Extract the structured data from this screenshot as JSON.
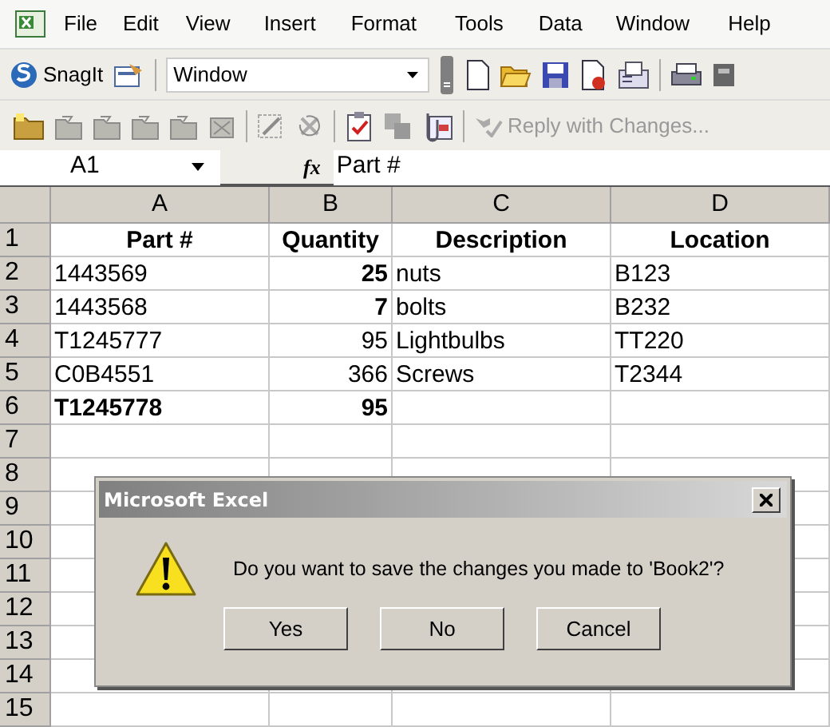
{
  "menu_bar": {
    "items": [
      "File",
      "Edit",
      "View",
      "Insert",
      "Format",
      "Tools",
      "Data",
      "Window",
      "Help"
    ]
  },
  "toolbar_1": {
    "snagit_label": "SnagIt",
    "capture_target": "Window"
  },
  "toolbar_2": {
    "reply_label": "Reply with Changes..."
  },
  "formula_bar": {
    "name_box": "A1",
    "function_label": "fx",
    "formula": "Part #"
  },
  "sheet": {
    "columns": [
      "A",
      "B",
      "C",
      "D"
    ],
    "rows": [
      {
        "number": "1",
        "kind": "header",
        "cells": [
          {
            "text": "Part #",
            "bold": true
          },
          {
            "text": "Quantity",
            "bold": true
          },
          {
            "text": "Description",
            "bold": true
          },
          {
            "text": "Location",
            "bold": true
          }
        ]
      },
      {
        "number": "2",
        "kind": "data",
        "cells": [
          {
            "text": "1443569",
            "bold": false
          },
          {
            "text": "25",
            "bold": true
          },
          {
            "text": "nuts",
            "bold": false
          },
          {
            "text": "B123",
            "bold": false
          }
        ]
      },
      {
        "number": "3",
        "kind": "data",
        "cells": [
          {
            "text": "1443568",
            "bold": false
          },
          {
            "text": "7",
            "bold": true
          },
          {
            "text": "bolts",
            "bold": false
          },
          {
            "text": "B232",
            "bold": false
          }
        ]
      },
      {
        "number": "4",
        "kind": "data",
        "cells": [
          {
            "text": "T1245777",
            "bold": false
          },
          {
            "text": "95",
            "bold": false
          },
          {
            "text": "Lightbulbs",
            "bold": false
          },
          {
            "text": "TT220",
            "bold": false
          }
        ]
      },
      {
        "number": "5",
        "kind": "data",
        "cells": [
          {
            "text": "C0B4551",
            "bold": false
          },
          {
            "text": "366",
            "bold": false
          },
          {
            "text": "Screws",
            "bold": false
          },
          {
            "text": "T2344",
            "bold": false
          }
        ]
      },
      {
        "number": "6",
        "kind": "data",
        "cells": [
          {
            "text": "T1245778",
            "bold": true
          },
          {
            "text": "95",
            "bold": true
          }
        ]
      },
      {
        "number": "7"
      },
      {
        "number": "8"
      },
      {
        "number": "9"
      },
      {
        "number": "10"
      },
      {
        "number": "11"
      },
      {
        "number": "12"
      },
      {
        "number": "13"
      },
      {
        "number": "14"
      },
      {
        "number": "15"
      }
    ]
  },
  "dialog": {
    "title": "Microsoft Excel",
    "message": "Do you want to save the changes you made to 'Book2'?",
    "buttons": [
      "Yes",
      "No",
      "Cancel"
    ]
  }
}
